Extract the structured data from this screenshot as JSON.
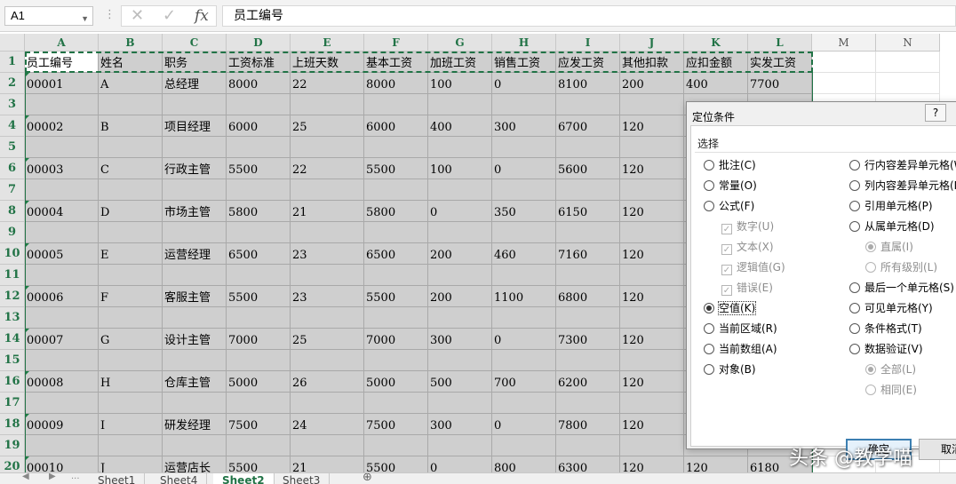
{
  "formula_bar": {
    "name_box": "A1",
    "name_box_arrow": "▼",
    "dots": "⋮",
    "cancel_icon": "✕",
    "enter_icon": "✓",
    "fx_icon": "fx",
    "formula": "员工编号"
  },
  "sheet": {
    "columns": [
      "A",
      "B",
      "C",
      "D",
      "E",
      "F",
      "G",
      "H",
      "I",
      "J",
      "K",
      "L",
      "M",
      "N"
    ],
    "rows": [
      "1",
      "2",
      "3",
      "4",
      "5",
      "6",
      "7",
      "8",
      "9",
      "10",
      "11",
      "12",
      "13",
      "14",
      "15",
      "16",
      "17",
      "18",
      "19",
      "20"
    ],
    "header_row": [
      "员工编号",
      "姓名",
      "职务",
      "工资标准",
      "上班天数",
      "基本工资",
      "加班工资",
      "销售工资",
      "应发工资",
      "其他扣款",
      "应扣金额",
      "实发工资"
    ],
    "data_rows": [
      [
        "00001",
        "A",
        "总经理",
        "8000",
        "22",
        "8000",
        "100",
        "0",
        "8100",
        "200",
        "400",
        "7700"
      ],
      [
        "",
        "",
        "",
        "",
        "",
        "",
        "",
        "",
        "",
        "",
        "",
        ""
      ],
      [
        "00002",
        "B",
        "项目经理",
        "6000",
        "25",
        "6000",
        "400",
        "300",
        "6700",
        "120",
        "",
        ""
      ],
      [
        "",
        "",
        "",
        "",
        "",
        "",
        "",
        "",
        "",
        "",
        "",
        ""
      ],
      [
        "00003",
        "C",
        "行政主管",
        "5500",
        "22",
        "5500",
        "100",
        "0",
        "5600",
        "120",
        "",
        ""
      ],
      [
        "",
        "",
        "",
        "",
        "",
        "",
        "",
        "",
        "",
        "",
        "",
        ""
      ],
      [
        "00004",
        "D",
        "市场主管",
        "5800",
        "21",
        "5800",
        "0",
        "350",
        "6150",
        "120",
        "",
        ""
      ],
      [
        "",
        "",
        "",
        "",
        "",
        "",
        "",
        "",
        "",
        "",
        "",
        ""
      ],
      [
        "00005",
        "E",
        "运营经理",
        "6500",
        "23",
        "6500",
        "200",
        "460",
        "7160",
        "120",
        "",
        ""
      ],
      [
        "",
        "",
        "",
        "",
        "",
        "",
        "",
        "",
        "",
        "",
        "",
        ""
      ],
      [
        "00006",
        "F",
        "客服主管",
        "5500",
        "23",
        "5500",
        "200",
        "1100",
        "6800",
        "120",
        "",
        ""
      ],
      [
        "",
        "",
        "",
        "",
        "",
        "",
        "",
        "",
        "",
        "",
        "",
        ""
      ],
      [
        "00007",
        "G",
        "设计主管",
        "7000",
        "25",
        "7000",
        "300",
        "0",
        "7300",
        "120",
        "",
        ""
      ],
      [
        "",
        "",
        "",
        "",
        "",
        "",
        "",
        "",
        "",
        "",
        "",
        ""
      ],
      [
        "00008",
        "H",
        "仓库主管",
        "5000",
        "26",
        "5000",
        "500",
        "700",
        "6200",
        "120",
        "",
        ""
      ],
      [
        "",
        "",
        "",
        "",
        "",
        "",
        "",
        "",
        "",
        "",
        "",
        ""
      ],
      [
        "00009",
        "I",
        "研发经理",
        "7500",
        "24",
        "7500",
        "300",
        "0",
        "7800",
        "120",
        "",
        ""
      ],
      [
        "",
        "",
        "",
        "",
        "",
        "",
        "",
        "",
        "",
        "",
        "",
        ""
      ],
      [
        "00010",
        "J",
        "运营店长",
        "5500",
        "21",
        "5500",
        "0",
        "800",
        "6300",
        "120",
        "120",
        "6180"
      ]
    ],
    "tabs": [
      "Sheet1",
      "Sheet4",
      "Sheet2",
      "Sheet3"
    ],
    "active_tab": "Sheet2",
    "tab_add": "⊕",
    "tab_nav_prev": "◀",
    "tab_nav_next": "▶",
    "tab_scroll_dots": "..."
  },
  "dialog": {
    "title": "定位条件",
    "help": "?",
    "group_label": "选择",
    "left_options": [
      {
        "label": "批注(C)",
        "type": "radio",
        "checked": false,
        "disabled": false
      },
      {
        "label": "常量(O)",
        "type": "radio",
        "checked": false,
        "disabled": false
      },
      {
        "label": "公式(F)",
        "type": "radio",
        "checked": false,
        "disabled": false
      },
      {
        "label": "数字(U)",
        "type": "check",
        "checked": true,
        "disabled": true
      },
      {
        "label": "文本(X)",
        "type": "check",
        "checked": true,
        "disabled": true
      },
      {
        "label": "逻辑值(G)",
        "type": "check",
        "checked": true,
        "disabled": true
      },
      {
        "label": "错误(E)",
        "type": "check",
        "checked": true,
        "disabled": true
      },
      {
        "label": "空值(K)",
        "type": "radio",
        "checked": true,
        "disabled": false
      },
      {
        "label": "当前区域(R)",
        "type": "radio",
        "checked": false,
        "disabled": false
      },
      {
        "label": "当前数组(A)",
        "type": "radio",
        "checked": false,
        "disabled": false
      },
      {
        "label": "对象(B)",
        "type": "radio",
        "checked": false,
        "disabled": false
      }
    ],
    "right_options": [
      {
        "label": "行内容差异单元格(W)",
        "type": "radio",
        "checked": false,
        "disabled": false
      },
      {
        "label": "列内容差异单元格(M)",
        "type": "radio",
        "checked": false,
        "disabled": false
      },
      {
        "label": "引用单元格(P)",
        "type": "radio",
        "checked": false,
        "disabled": false
      },
      {
        "label": "从属单元格(D)",
        "type": "radio",
        "checked": false,
        "disabled": false
      },
      {
        "label": "直属(I)",
        "type": "radio",
        "checked": true,
        "disabled": true
      },
      {
        "label": "所有级别(L)",
        "type": "radio",
        "checked": false,
        "disabled": true
      },
      {
        "label": "最后一个单元格(S)",
        "type": "radio",
        "checked": false,
        "disabled": false
      },
      {
        "label": "可见单元格(Y)",
        "type": "radio",
        "checked": false,
        "disabled": false
      },
      {
        "label": "条件格式(T)",
        "type": "radio",
        "checked": false,
        "disabled": false
      },
      {
        "label": "数据验证(V)",
        "type": "radio",
        "checked": false,
        "disabled": false
      },
      {
        "label": "全部(L)",
        "type": "radio",
        "checked": true,
        "disabled": true
      },
      {
        "label": "相同(E)",
        "type": "radio",
        "checked": false,
        "disabled": true
      }
    ],
    "ok_label": "确定",
    "cancel_label": "取消"
  },
  "watermark": "头条 @教学喵",
  "colors": {
    "selection": "#217346",
    "selected_fill": "#cfcfcf",
    "header_fill": "#e3e3e3"
  }
}
